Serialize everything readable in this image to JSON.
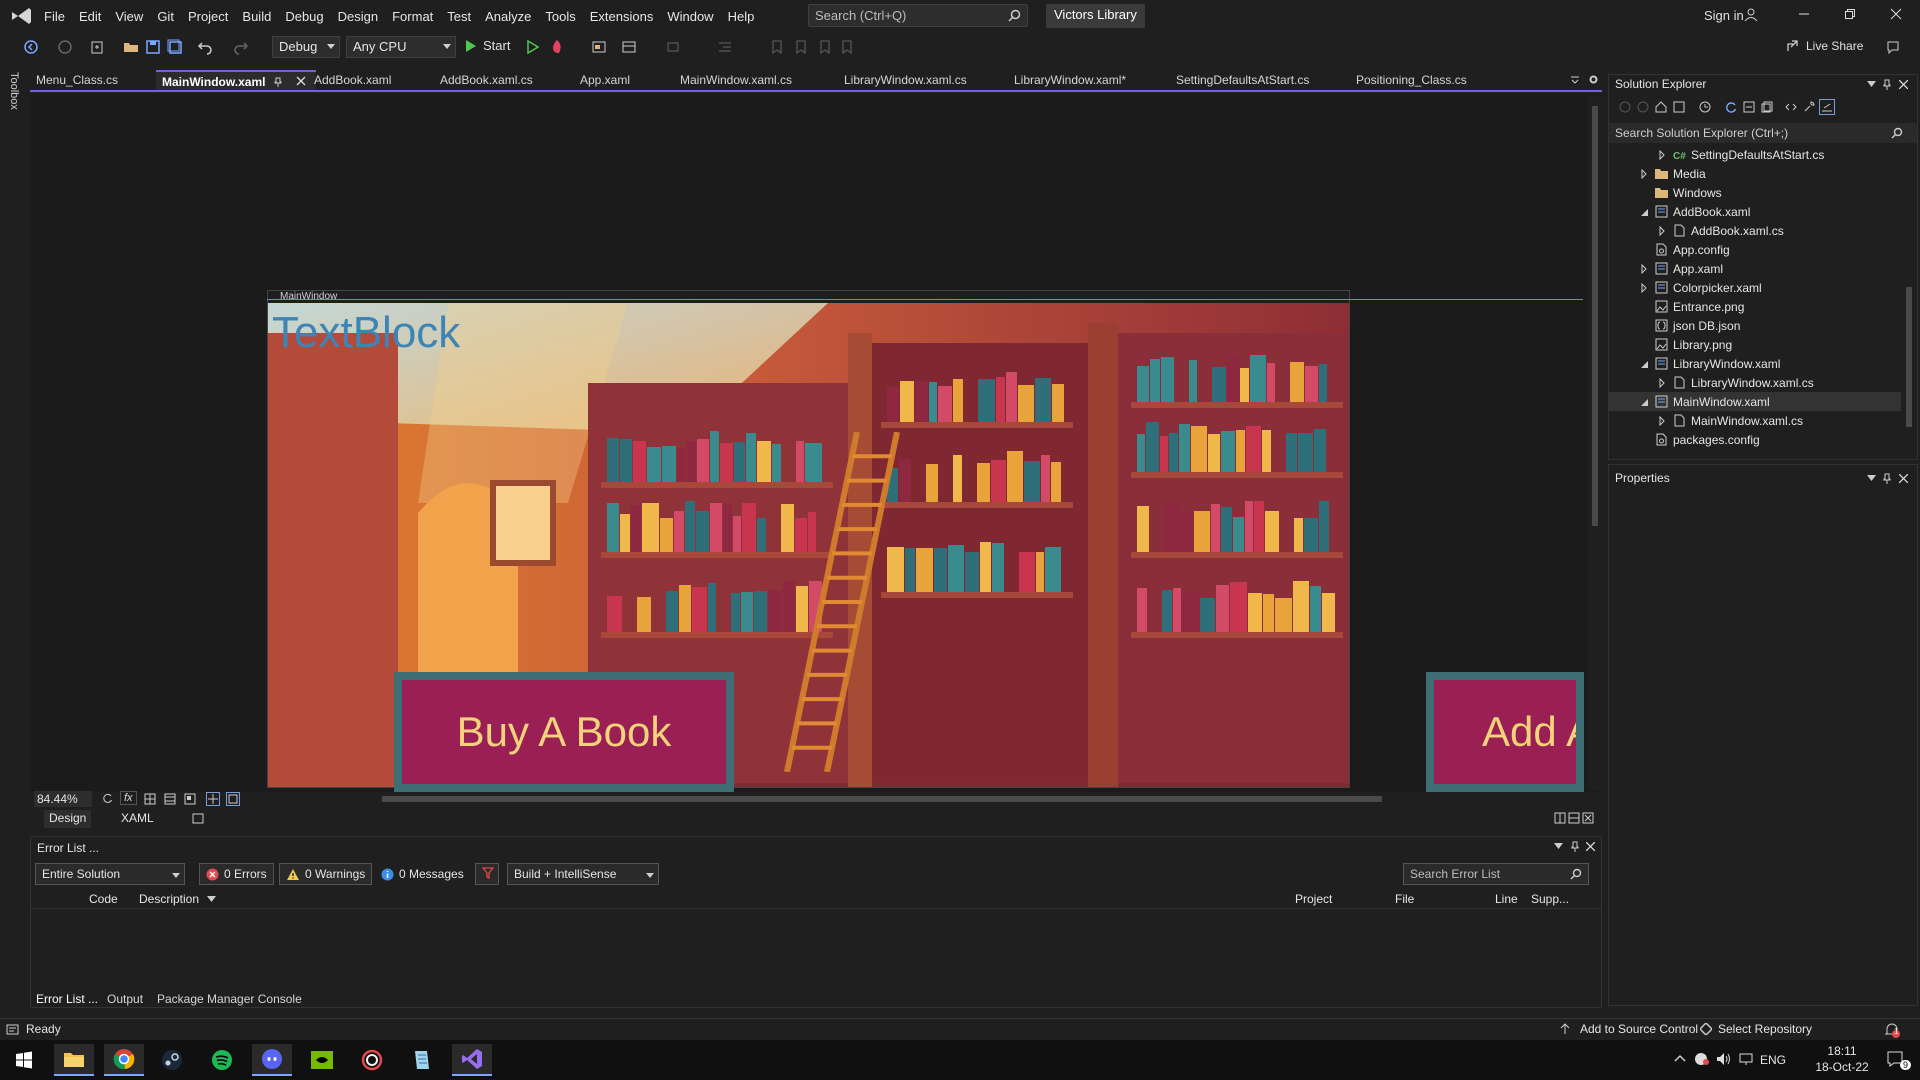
{
  "menu": {
    "items": [
      "File",
      "Edit",
      "View",
      "Git",
      "Project",
      "Build",
      "Debug",
      "Design",
      "Format",
      "Test",
      "Analyze",
      "Tools",
      "Extensions",
      "Window",
      "Help"
    ],
    "search_placeholder": "Search (Ctrl+Q)",
    "solution_name": "Victors Library",
    "sign_in": "Sign in",
    "live_share": "Live Share"
  },
  "toolbar": {
    "config": "Debug",
    "platform": "Any CPU",
    "start": "Start"
  },
  "toolbox_label": "Toolbox",
  "doc_tabs": [
    {
      "label": "Menu_Class.cs"
    },
    {
      "label": "MainWindow.xaml"
    },
    {
      "label": "AddBook.xaml"
    },
    {
      "label": "AddBook.xaml.cs"
    },
    {
      "label": "App.xaml"
    },
    {
      "label": "MainWindow.xaml.cs"
    },
    {
      "label": "LibraryWindow.xaml.cs"
    },
    {
      "label": "LibraryWindow.xaml*"
    },
    {
      "label": "SettingDefaultsAtStart.cs"
    },
    {
      "label": "Positioning_Class.cs"
    }
  ],
  "designer": {
    "window_title": "MainWindow",
    "textblock": "TextBlock",
    "buy_button": "Buy A Book",
    "add_button": "Add A",
    "zoom": "84.44%",
    "fx": "fx",
    "design_tab": "Design",
    "xaml_tab": "XAML"
  },
  "error_list": {
    "title": "Error List ...",
    "scope": "Entire Solution",
    "errors": "0 Errors",
    "warnings": "0 Warnings",
    "messages": "0 Messages",
    "build_filter": "Build + IntelliSense",
    "search_placeholder": "Search Error List",
    "columns": [
      "Code",
      "Description",
      "Project",
      "File",
      "Line",
      "Supp..."
    ]
  },
  "bottom_tabs": [
    "Error List ...",
    "Output",
    "Package Manager Console"
  ],
  "solution_explorer": {
    "title": "Solution Explorer",
    "search_placeholder": "Search Solution Explorer (Ctrl+;)",
    "items": [
      {
        "label": "SettingDefaultsAtStart.cs",
        "expander": "collapsed",
        "icon": "csharp"
      },
      {
        "label": "Media",
        "expander": "collapsed",
        "icon": "folder"
      },
      {
        "label": "Windows",
        "expander": "none",
        "icon": "folder"
      },
      {
        "label": "AddBook.xaml",
        "expander": "expanded",
        "icon": "xaml"
      },
      {
        "label": "AddBook.xaml.cs",
        "expander": "collapsed",
        "icon": "file"
      },
      {
        "label": "App.config",
        "expander": "none",
        "icon": "config"
      },
      {
        "label": "App.xaml",
        "expander": "collapsed",
        "icon": "xaml"
      },
      {
        "label": "Colorpicker.xaml",
        "expander": "collapsed",
        "icon": "xaml"
      },
      {
        "label": "Entrance.png",
        "expander": "none",
        "icon": "image"
      },
      {
        "label": "json DB.json",
        "expander": "none",
        "icon": "json"
      },
      {
        "label": "Library.png",
        "expander": "none",
        "icon": "image"
      },
      {
        "label": "LibraryWindow.xaml",
        "expander": "expanded",
        "icon": "xaml"
      },
      {
        "label": "LibraryWindow.xaml.cs",
        "expander": "collapsed",
        "icon": "file"
      },
      {
        "label": "MainWindow.xaml",
        "expander": "expanded",
        "icon": "xaml",
        "selected": true
      },
      {
        "label": "MainWindow.xaml.cs",
        "expander": "collapsed",
        "icon": "file"
      },
      {
        "label": "packages.config",
        "expander": "none",
        "icon": "config"
      }
    ]
  },
  "properties": {
    "title": "Properties"
  },
  "statusbar": {
    "ready": "Ready",
    "source_control": "Add to Source Control",
    "repository": "Select Repository",
    "notifications": "1"
  },
  "taskbar": {
    "apps": [
      "windows-start-icon",
      "file-explorer-icon",
      "chrome-icon",
      "steam-icon",
      "spotify-icon",
      "discord-icon",
      "nvidia-icon",
      "app-spiral-icon",
      "notepad-icon",
      "visual-studio-icon"
    ],
    "language": "ENG",
    "time": "18:11",
    "date": "18-Oct-22",
    "badge": "9"
  },
  "colors": {
    "accent": "#7a5ee0",
    "button_fill": "#9a1f55",
    "button_text": "#f2d27a",
    "textblock": "#3e84b4"
  }
}
